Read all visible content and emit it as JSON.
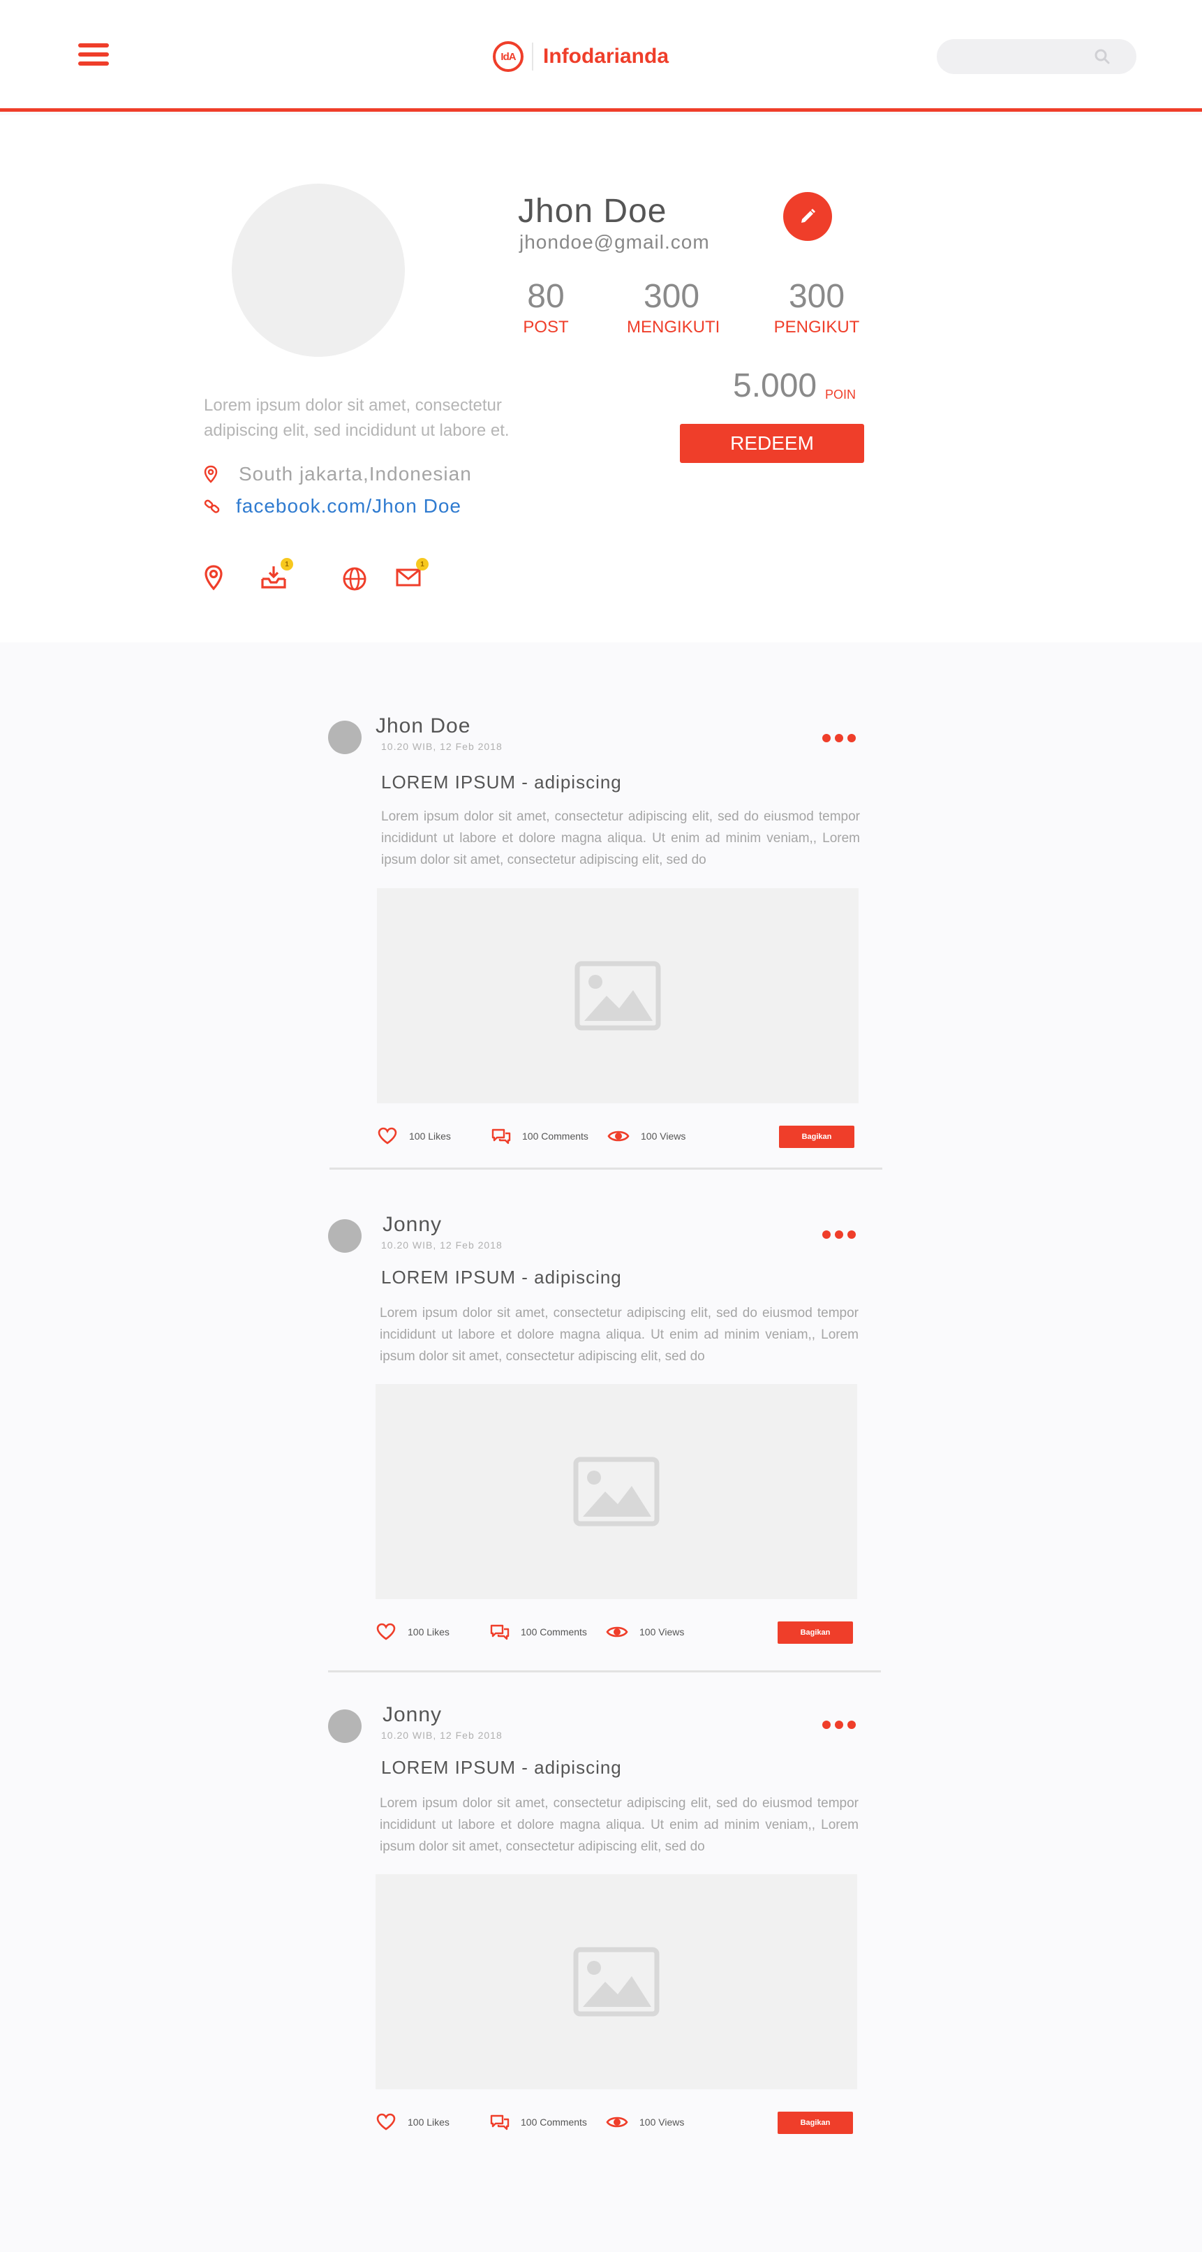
{
  "header": {
    "logo_text": "IdA",
    "brand_name": "Infodarianda",
    "search_placeholder": ""
  },
  "profile": {
    "name": "Jhon Doe",
    "email": "jhondoe@gmail.com",
    "bio": "Lorem ipsum dolor sit amet, consectetur adipiscing elit, sed incididunt ut labore et.",
    "location": "South jakarta,Indonesian",
    "link": "facebook.com/Jhon Doe",
    "stats": [
      {
        "value": "80",
        "label": "POST"
      },
      {
        "value": "300",
        "label": "MENGIKUTI"
      },
      {
        "value": "300",
        "label": "PENGIKUT"
      }
    ],
    "points": "5.000",
    "points_label": "POIN",
    "redeem_label": "REDEEM",
    "icon_badges": {
      "inbox": "1",
      "mail": "1"
    }
  },
  "posts": [
    {
      "author": "Jhon Doe",
      "time": "10.20 WIB, 12 Feb 2018",
      "title": "LOREM IPSUM - adipiscing",
      "body": "Lorem ipsum dolor sit amet, consectetur adipiscing elit, sed do eiusmod tempor incididunt ut labore et dolore magna aliqua. Ut enim ad minim veniam,, Lorem ipsum dolor sit amet, consectetur adipiscing elit, sed do",
      "likes": "100 Likes",
      "comments": "100 Comments",
      "views": "100 Views",
      "share_label": "Bagikan"
    },
    {
      "author": "Jonny",
      "time": "10.20 WIB, 12 Feb 2018",
      "title": "LOREM IPSUM - adipiscing",
      "body": "Lorem ipsum dolor sit amet, consectetur adipiscing elit, sed do eiusmod tempor incididunt ut labore et dolore magna aliqua. Ut enim ad minim veniam,, Lorem ipsum dolor sit amet, consectetur adipiscing elit, sed do",
      "likes": "100 Likes",
      "comments": "100 Comments",
      "views": "100 Views",
      "share_label": "Bagikan"
    },
    {
      "author": "Jonny",
      "time": "10.20 WIB, 12 Feb 2018",
      "title": "LOREM IPSUM - adipiscing",
      "body": "Lorem ipsum dolor sit amet, consectetur adipiscing elit, sed do eiusmod tempor incididunt ut labore et dolore magna aliqua. Ut enim ad minim veniam,, Lorem ipsum dolor sit amet, consectetur adipiscing elit, sed do",
      "likes": "100 Likes",
      "comments": "100 Comments",
      "views": "100 Views",
      "share_label": "Bagikan"
    }
  ],
  "colors": {
    "accent": "#ef3e2a",
    "link": "#2f7bd0",
    "badge": "#f7c81e",
    "placeholder": "#f1f1f1"
  }
}
